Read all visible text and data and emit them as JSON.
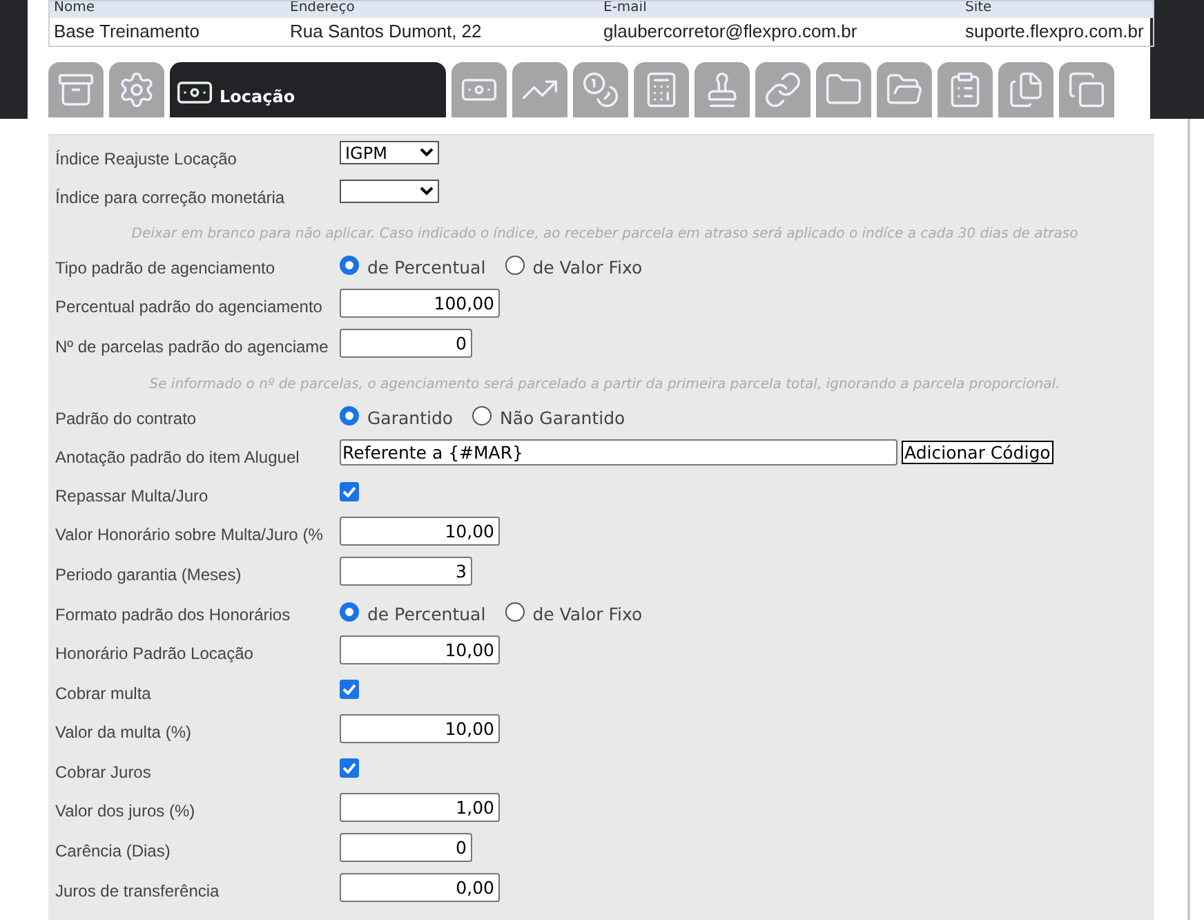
{
  "contact_table": {
    "columns": [
      "Nome",
      "Endereço",
      "E-mail",
      "Site"
    ],
    "row": [
      "Base Treinamento",
      "Rua Santos Dumont, 22",
      "glaubercorretor@flexpro.com.br",
      "suporte.flexpro.com.br"
    ]
  },
  "tabs": [
    {
      "selected": false
    },
    {
      "selected": false
    },
    {
      "selected": true,
      "label": "Locação"
    },
    {
      "selected": false
    },
    {
      "selected": false
    },
    {
      "selected": false
    },
    {
      "selected": false
    },
    {
      "selected": false
    },
    {
      "selected": false
    },
    {
      "selected": false
    },
    {
      "selected": false
    },
    {
      "selected": false
    },
    {
      "selected": false
    },
    {
      "selected": false
    }
  ],
  "form": [
    {
      "kind": "select",
      "label": "Índice Reajuste Locação",
      "value": "IGPM"
    },
    {
      "kind": "select",
      "label": "Índice para correção monetária"
    },
    {
      "kind": "note",
      "text": "Deixar em branco para não aplicar. Caso indicado o índice, ao receber parcela em atraso será aplicado o indíce a cada 30 dias de atraso"
    },
    {
      "kind": "radio",
      "label": "Tipo padrão de agenciamento",
      "options": [
        {
          "label": "de Percentual",
          "selected": true
        },
        {
          "label": "de Valor Fixo",
          "selected": false
        }
      ]
    },
    {
      "kind": "decimal",
      "label": "Percentual padrão do agenciamento",
      "value": "100,00"
    },
    {
      "kind": "integer",
      "label": "Nº de parcelas padrão do agenciame",
      "value": "0"
    },
    {
      "kind": "note",
      "text": "Se informado o nº de parcelas, o agenciamento será parcelado a partir da primeira parcela total, ignorando a parcela proporcional."
    },
    {
      "kind": "radio",
      "label": "Padrão do contrato",
      "options": [
        {
          "label": "Garantido",
          "selected": true
        },
        {
          "label": "Não Garantido",
          "selected": false
        }
      ]
    },
    {
      "kind": "text",
      "label": "Anotação padrão do item Aluguel",
      "value": "Referente a {#MAR}",
      "button": "Adicionar Código"
    },
    {
      "kind": "checkbox",
      "label": "Repassar Multa/Juro",
      "checked": true
    },
    {
      "kind": "decimal",
      "label": "Valor Honorário sobre Multa/Juro (%",
      "value": "10,00"
    },
    {
      "kind": "integer",
      "label": "Periodo garantia (Meses)",
      "value": "3"
    },
    {
      "kind": "radio",
      "label": "Formato padrão dos Honorários",
      "options": [
        {
          "label": "de Percentual",
          "selected": true
        },
        {
          "label": "de Valor Fixo",
          "selected": false
        }
      ]
    },
    {
      "kind": "decimal",
      "label": "Honorário Padrão Locação",
      "value": "10,00"
    },
    {
      "kind": "checkbox",
      "label": "Cobrar multa",
      "checked": true
    },
    {
      "kind": "decimal",
      "label": "Valor da multa (%)",
      "value": "10,00"
    },
    {
      "kind": "checkbox",
      "label": "Cobrar Juros",
      "checked": true
    },
    {
      "kind": "decimal",
      "label": "Valor dos juros (%)",
      "value": "1,00"
    },
    {
      "kind": "integer",
      "label": "Carência (Dias)",
      "value": "0"
    },
    {
      "kind": "decimal",
      "label": "Juros de transferência",
      "value": "0,00"
    }
  ]
}
